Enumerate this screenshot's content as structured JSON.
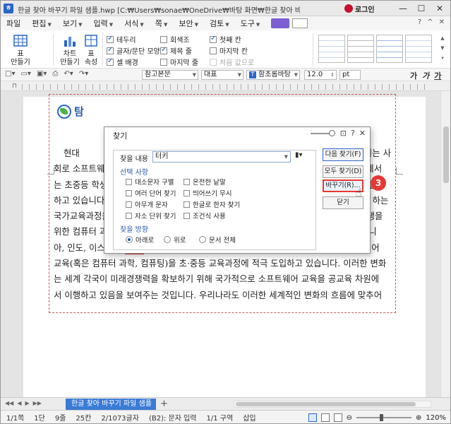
{
  "window": {
    "title": "한글 찾아 바꾸기 파일 샘플.hwp [C:₩Users₩sonae₩OneDrive₩바탕 화면₩한글 찾아 바꾸기 문서 텍스트 글자 수정 방법₩]",
    "app_icon": "ㅎ",
    "login_label": "로그인",
    "controls": [
      "—",
      "☐",
      "✕"
    ]
  },
  "menu": {
    "items": [
      "파일",
      "편집",
      "보기",
      "입력",
      "서식",
      "쪽",
      "보안",
      "검토",
      "도구"
    ],
    "right": [
      "?",
      "^",
      "✕"
    ]
  },
  "ribbon": {
    "big_buttons": [
      {
        "label": "표\n만들기"
      },
      {
        "label": "차트\n만들기"
      },
      {
        "label": "표\n속성"
      }
    ],
    "checks_col1": [
      {
        "label": "테두리",
        "checked": true
      },
      {
        "label": "글자/문단 모양",
        "checked": true
      },
      {
        "label": "셀 배경",
        "checked": true
      }
    ],
    "checks_col2": [
      {
        "label": "회색조",
        "checked": false
      },
      {
        "label": "제목 줄",
        "checked": true
      },
      {
        "label": "마지막 줄",
        "checked": false
      }
    ],
    "checks_col3": [
      {
        "label": "첫째 칸",
        "checked": true
      },
      {
        "label": "마지막 칸",
        "checked": false
      },
      {
        "label": "처음 값으로",
        "checked": false,
        "dim": true
      }
    ]
  },
  "format_bar": {
    "style": "참고본문",
    "lang": "대표",
    "font": "함초롬바탕",
    "size": "12.0",
    "unit": "pt"
  },
  "document": {
    "heading": "탐",
    "lines": [
      {
        "parts": [
          {
            "t": "현대"
          },
          {
            "t": "이 되는 사"
          }
        ]
      },
      {
        "parts": [
          {
            "t": "회로 소프트웨어와 관련된 역량이 매우 중요합니다. 따라서 선진국을 중심으로 각 국가에서"
          }
        ]
      },
      {
        "parts": [
          {
            "t": "는 초중등 학생의 소프트웨어 관련 역량을 기르기 위한 다양한 교육적 제도와 환경을 마련"
          }
        ]
      },
      {
        "parts": [
          {
            "t": "하고 있습니다. 영국은 2014년 9월부터 초·중등학생을 대상으로 컴퓨팅 교육을 필수로 하는"
          }
        ]
      },
      {
        "parts": [
          {
            "t": "국가교육과정을 시행하였으며, 미국도 2016년 1월에 오바마 대통령이 초중등 모든 학생을"
          }
        ]
      },
      {
        "parts": [
          {
            "t": "위한 컴퓨터 과학 교육 정책을 추진하겠다고 발표하였습니다. 이 밖에도 핀란드, 에스토니"
          }
        ]
      },
      {
        "parts": [
          {
            "t": "아, 인도, 이스라엘, "
          },
          {
            "t": "터키",
            "hl": true
          },
          {
            "t": " 일본 등 주요국들은 알고리즘과 프로그래밍이 포함된 소프트웨어"
          }
        ]
      },
      {
        "parts": [
          {
            "t": "교육(혹은 컴퓨터 과학, 컴퓨팅)을 초·중등 교육과정에 적극 도입하고 있습니다. 이러한 변화"
          }
        ]
      },
      {
        "parts": [
          {
            "t": "는 세계 각국이 미래경쟁력을 확보하기 위해 국가적으로 소프트웨어 교육을 공교육 차원에"
          }
        ]
      },
      {
        "parts": [
          {
            "t": "서 이행하고 있음을 보여주는 것입니다. 우리나라도 이러한 세계적인 변화의 흐름에 맞추어"
          }
        ]
      }
    ]
  },
  "dialog": {
    "title": "찾기",
    "controls": [
      "⊡",
      "?",
      "✕"
    ],
    "find_label": "찾을 내용",
    "find_value": "터키",
    "options_heading": "선택 사항",
    "options_col1": [
      "대소문자 구별",
      "여러 단어 찾기",
      "아무개 문자",
      "자소 단위 찾기"
    ],
    "options_col2": [
      "온전한 낱말",
      "띄어쓰기 무시",
      "한글로 한자 찾기",
      "조건식 사용"
    ],
    "direction_heading": "찾을 방향",
    "directions": [
      {
        "label": "아래로",
        "selected": true
      },
      {
        "label": "위로",
        "selected": false
      },
      {
        "label": "문서 전체",
        "selected": false
      }
    ],
    "buttons": {
      "find_next": "다음 찾기(F)",
      "find_all": "모두 찾기(D)",
      "replace": "바꾸기(R)...",
      "close": "닫기"
    }
  },
  "annotation": {
    "step": "3"
  },
  "tabs": {
    "active": "한글 찾아 바꾸기 파일 샘플",
    "add": "+"
  },
  "status": {
    "items": [
      "1/1쪽",
      "1단",
      "9줄",
      "25칸",
      "2/1073글자",
      "(B2): 문자 입력",
      "1/1 구역",
      "삽입"
    ],
    "zoom": "120%",
    "zoom_value": 120
  },
  "colors": {
    "accent": "#2a67c8",
    "highlight": "#e53935",
    "tab_active": "#3a7bd5"
  }
}
